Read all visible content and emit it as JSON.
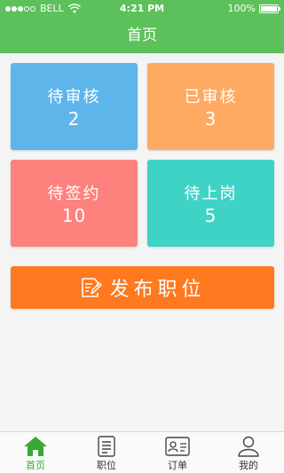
{
  "status_bar": {
    "carrier": "BELL",
    "time": "4:21 PM",
    "battery": "100%",
    "battery_level": 1.0
  },
  "header": {
    "title": "首页"
  },
  "tiles": [
    {
      "label": "待审核",
      "count": "2",
      "color": "#5eb5e9"
    },
    {
      "label": "已审核",
      "count": "3",
      "color": "#ffaa62"
    },
    {
      "label": "待签约",
      "count": "10",
      "color": "#fd817d"
    },
    {
      "label": "待上岗",
      "count": "5",
      "color": "#3fd3c5"
    }
  ],
  "post_button": {
    "label": "发布职位",
    "icon": "edit-document-icon",
    "color": "#ff7920"
  },
  "tabbar": {
    "items": [
      {
        "label": "首页",
        "icon": "home-icon",
        "active": true
      },
      {
        "label": "职位",
        "icon": "document-list-icon",
        "active": false
      },
      {
        "label": "订单",
        "icon": "id-card-icon",
        "active": false
      },
      {
        "label": "我的",
        "icon": "user-icon",
        "active": false
      }
    ],
    "active_color": "#3aa835"
  },
  "colors": {
    "header": "#5cc15a",
    "background": "#f4f4f4"
  }
}
